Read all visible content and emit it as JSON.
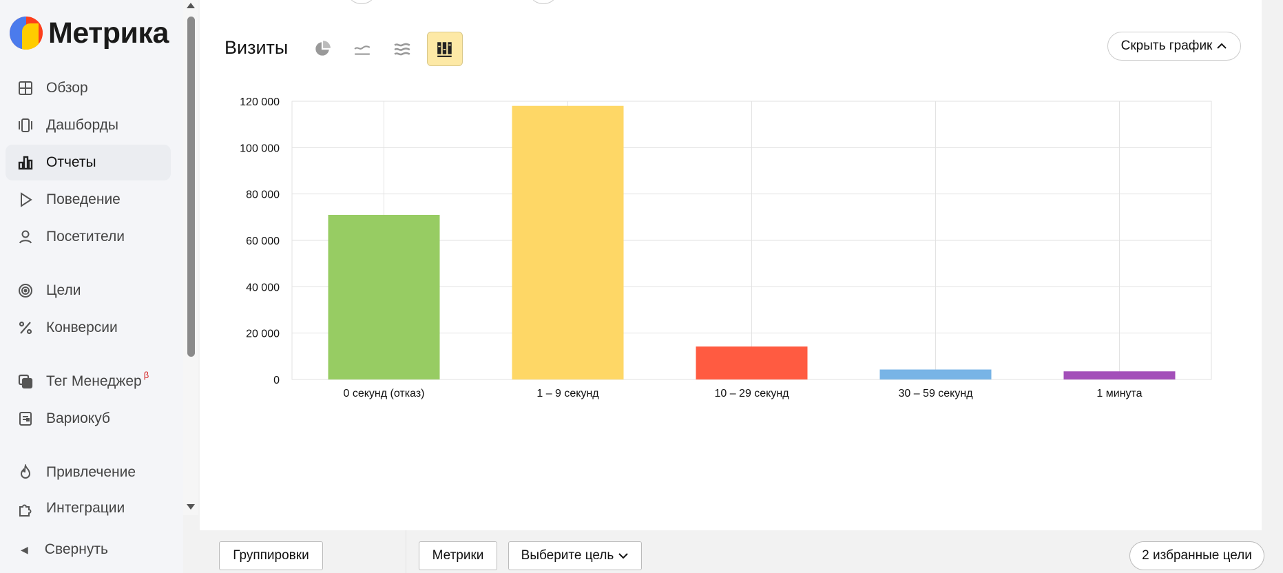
{
  "brand": {
    "name": "Метрика"
  },
  "sidebar": {
    "items": [
      {
        "label": "Обзор",
        "icon": "grid-icon"
      },
      {
        "label": "Дашборды",
        "icon": "dashboards-icon"
      },
      {
        "label": "Отчеты",
        "icon": "bar-chart-icon",
        "active": true
      },
      {
        "label": "Поведение",
        "icon": "play-icon"
      },
      {
        "label": "Посетители",
        "icon": "user-icon"
      },
      {
        "label": "Цели",
        "icon": "target-icon"
      },
      {
        "label": "Конверсии",
        "icon": "percent-icon"
      },
      {
        "label": "Тег Менеджер",
        "icon": "tag-manager-icon",
        "badge": "β"
      },
      {
        "label": "Вариокуб",
        "icon": "variocube-icon"
      },
      {
        "label": "Привлечение",
        "icon": "fire-icon"
      },
      {
        "label": "Интеграции",
        "icon": "puzzle-icon"
      }
    ],
    "collapse_label": "Свернуть"
  },
  "chart_panel": {
    "title": "Визиты",
    "hide_chart_label": "Скрыть график",
    "chart_types": [
      {
        "name": "pie",
        "active": false
      },
      {
        "name": "line",
        "active": false
      },
      {
        "name": "area",
        "active": false
      },
      {
        "name": "bar",
        "active": true
      }
    ]
  },
  "chart_data": {
    "type": "bar",
    "title": "",
    "xlabel": "",
    "ylabel": "",
    "categories": [
      "0 секунд (отказ)",
      "1 – 9 секунд",
      "10 – 29 секунд",
      "30 – 59 секунд",
      "1 минута"
    ],
    "values": [
      71000,
      118000,
      14200,
      4300,
      3500
    ],
    "colors": [
      "#97cc63",
      "#fed766",
      "#ff5b41",
      "#78b4e6",
      "#a34fb9"
    ],
    "ylim": [
      0,
      120000
    ],
    "yticks": [
      0,
      20000,
      40000,
      60000,
      80000,
      100000,
      120000
    ],
    "ytick_labels": [
      "0",
      "20 000",
      "40 000",
      "60 000",
      "80 000",
      "100 000",
      "120 000"
    ],
    "grid": true,
    "legend": "none"
  },
  "bottom": {
    "groupings_label": "Группировки",
    "metrics_label": "Метрики",
    "goal_label": "Выберите цель",
    "favorites_label": "2 избранные цели"
  }
}
